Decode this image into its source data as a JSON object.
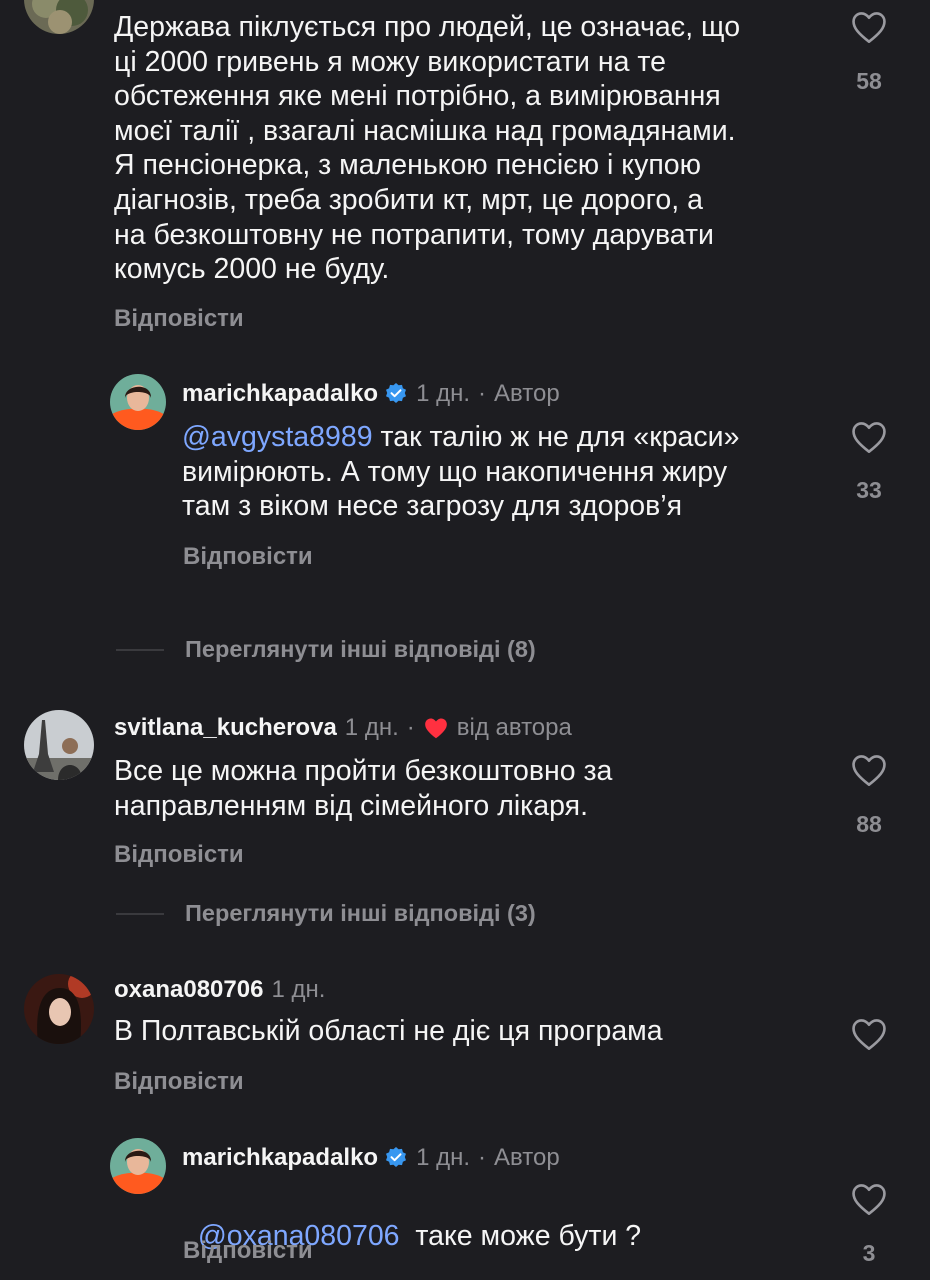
{
  "comments": [
    {
      "text_lines": [
        "Держава піклується про людей, це означає, що",
        "ці 2000 гривень я можу використати на те",
        "обстеження яке мені потрібно, а вимірювання",
        "моєї талії , взагалі насмішка над громадянами.",
        "Я пенсіонерка, з маленькою пенсією і купою",
        "діагнозів, треба зробити кт, мрт, це дорого, а",
        "на безкоштовну не потрапити, тому дарувати",
        "комусь 2000 не буду."
      ],
      "likes": "58",
      "reply_label": "Відповісти"
    },
    {
      "username": "marichkapadalko",
      "time": "1 дн.",
      "separator": "·",
      "author_label": "Автор",
      "mention": "@avgysta8989",
      "text_line1_rest": " так талію ж не для «краси»",
      "text_line2": "вимірюють. А тому що накопичення жиру",
      "text_line3": "там з віком несе загрозу для здоров’я",
      "likes": "33",
      "reply_label": "Відповісти"
    },
    {
      "view_more": "Переглянути інші відповіді (8)"
    },
    {
      "username": "svitlana_kucherova",
      "time": "1 дн.",
      "separator": "·",
      "liked_by_author": "від автора",
      "text_lines": [
        "Все це можна пройти безкоштовно за",
        "направленням від сімейного лікаря."
      ],
      "likes": "88",
      "reply_label": "Відповісти"
    },
    {
      "view_more": "Переглянути інші відповіді (3)"
    },
    {
      "username": "oxana080706",
      "time": "1 дн.",
      "text_lines": [
        "В Полтавській області не діє ця програма"
      ],
      "likes": "",
      "reply_label": "Відповісти"
    },
    {
      "username": "marichkapadalko",
      "time": "1 дн.",
      "separator": "·",
      "author_label": "Автор",
      "mention": "@oxana080706",
      "text_rest": "  таке може бути ?",
      "likes": "3",
      "reply_label": "Відповісти"
    }
  ],
  "colors": {
    "background": "#1d1d21",
    "text": "#f5f5f5",
    "secondary": "#8e8e93",
    "mention": "#7ea7ff",
    "verified": "#3897f0",
    "heart_red": "#ff3040"
  },
  "icons": [
    "heart-icon",
    "verified-badge-icon",
    "red-heart-icon"
  ]
}
